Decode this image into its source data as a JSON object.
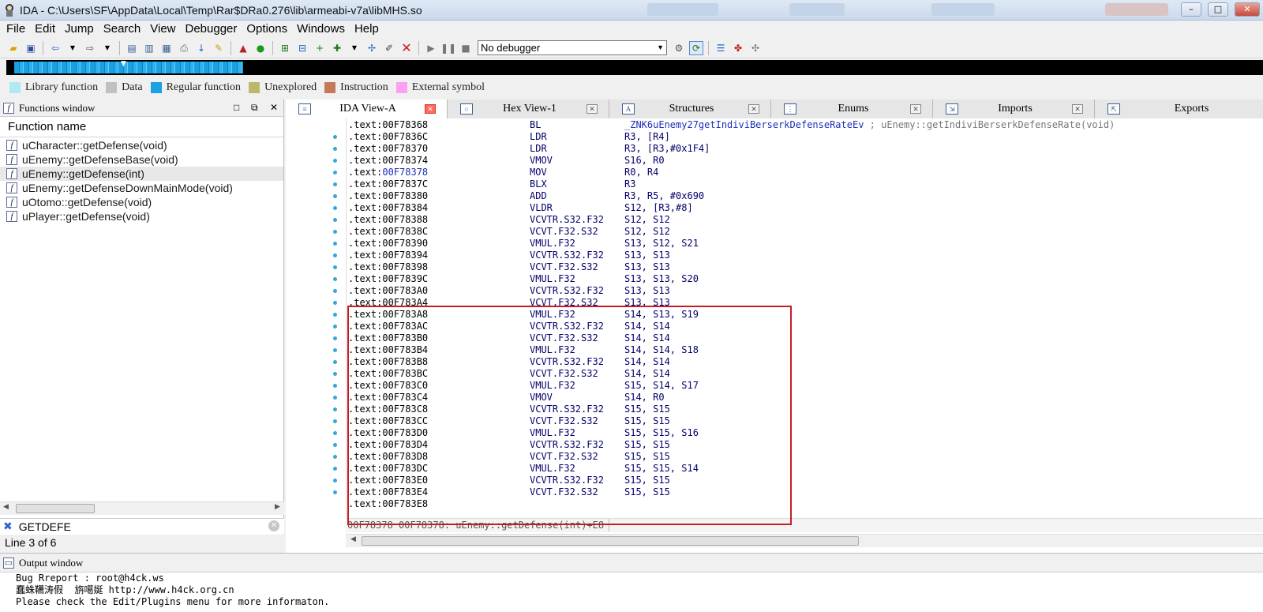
{
  "window": {
    "title": "IDA - C:\\Users\\SF\\AppData\\Local\\Temp\\Rar$DRa0.276\\lib\\armeabi-v7a\\libMHS.so"
  },
  "menu": [
    "File",
    "Edit",
    "Jump",
    "Search",
    "View",
    "Debugger",
    "Options",
    "Windows",
    "Help"
  ],
  "toolbar": {
    "debugger_select": "No debugger"
  },
  "legend": [
    {
      "label": "Library function",
      "color": "#aeeaf6"
    },
    {
      "label": "Data",
      "color": "#c0c0c0"
    },
    {
      "label": "Regular function",
      "color": "#1ba0e2"
    },
    {
      "label": "Unexplored",
      "color": "#bdb76b"
    },
    {
      "label": "Instruction",
      "color": "#c47a5a"
    },
    {
      "label": "External symbol",
      "color": "#ff9ff3"
    }
  ],
  "functions_window": {
    "title": "Functions window",
    "column": "Function name",
    "items": [
      "uCharacter::getDefense(void)",
      "uEnemy::getDefenseBase(void)",
      "uEnemy::getDefense(int)",
      "uEnemy::getDefenseDownMainMode(void)",
      "uOtomo::getDefense(void)",
      "uPlayer::getDefense(void)"
    ],
    "search_text": "GETDEFE",
    "status": "Line 3 of 6"
  },
  "tabs": [
    {
      "label": "IDA View-A",
      "icon": "ida-view-icon"
    },
    {
      "label": "Hex View-1",
      "icon": "hex-icon"
    },
    {
      "label": "Structures",
      "icon": "structures-icon"
    },
    {
      "label": "Enums",
      "icon": "enums-icon"
    },
    {
      "label": "Imports",
      "icon": "imports-icon"
    },
    {
      "label": "Exports",
      "icon": "exports-icon"
    }
  ],
  "disasm": {
    "lines": [
      {
        "seg": ".text:",
        "addr": "00F78368",
        "mn": "BL",
        "ops": "_ZNK6uEnemy27getIndiviBerserkDefenseRateEv",
        "comment": " ; uEnemy::getIndiviBerserkDefenseRate(void)"
      },
      {
        "seg": ".text:",
        "addr": "00F7836C",
        "mn": "LDR",
        "ops": "R3, [R4]",
        "comment": ""
      },
      {
        "seg": ".text:",
        "addr": "00F78370",
        "mn": "LDR",
        "ops": "R3, [R3,#0x1F4]",
        "comment": ""
      },
      {
        "seg": ".text:",
        "addr": "00F78374",
        "mn": "VMOV",
        "ops": "S16, R0",
        "comment": ""
      },
      {
        "seg": ".text:",
        "addr": "00F78378",
        "mn": "MOV",
        "ops": "R0, R4",
        "comment": ""
      },
      {
        "seg": ".text:",
        "addr": "00F7837C",
        "mn": "BLX",
        "ops": "R3",
        "comment": ""
      },
      {
        "seg": ".text:",
        "addr": "00F78380",
        "mn": "ADD",
        "ops": "R3, R5, #0x690",
        "comment": ""
      },
      {
        "seg": ".text:",
        "addr": "00F78384",
        "mn": "VLDR",
        "ops": "S12, [R3,#8]",
        "comment": ""
      },
      {
        "seg": ".text:",
        "addr": "00F78388",
        "mn": "VCVTR.S32.F32",
        "ops": "S12, S12",
        "comment": ""
      },
      {
        "seg": ".text:",
        "addr": "00F7838C",
        "mn": "VCVT.F32.S32",
        "ops": "S12, S12",
        "comment": ""
      },
      {
        "seg": ".text:",
        "addr": "00F78390",
        "mn": "VMUL.F32",
        "ops": "S13, S12, S21",
        "comment": ""
      },
      {
        "seg": ".text:",
        "addr": "00F78394",
        "mn": "VCVTR.S32.F32",
        "ops": "S13, S13",
        "comment": ""
      },
      {
        "seg": ".text:",
        "addr": "00F78398",
        "mn": "VCVT.F32.S32",
        "ops": "S13, S13",
        "comment": ""
      },
      {
        "seg": ".text:",
        "addr": "00F7839C",
        "mn": "VMUL.F32",
        "ops": "S13, S13, S20",
        "comment": ""
      },
      {
        "seg": ".text:",
        "addr": "00F783A0",
        "mn": "VCVTR.S32.F32",
        "ops": "S13, S13",
        "comment": ""
      },
      {
        "seg": ".text:",
        "addr": "00F783A4",
        "mn": "VCVT.F32.S32",
        "ops": "S13, S13",
        "comment": ""
      },
      {
        "seg": ".text:",
        "addr": "00F783A8",
        "mn": "VMUL.F32",
        "ops": "S14, S13, S19",
        "comment": ""
      },
      {
        "seg": ".text:",
        "addr": "00F783AC",
        "mn": "VCVTR.S32.F32",
        "ops": "S14, S14",
        "comment": ""
      },
      {
        "seg": ".text:",
        "addr": "00F783B0",
        "mn": "VCVT.F32.S32",
        "ops": "S14, S14",
        "comment": ""
      },
      {
        "seg": ".text:",
        "addr": "00F783B4",
        "mn": "VMUL.F32",
        "ops": "S14, S14, S18",
        "comment": ""
      },
      {
        "seg": ".text:",
        "addr": "00F783B8",
        "mn": "VCVTR.S32.F32",
        "ops": "S14, S14",
        "comment": ""
      },
      {
        "seg": ".text:",
        "addr": "00F783BC",
        "mn": "VCVT.F32.S32",
        "ops": "S14, S14",
        "comment": ""
      },
      {
        "seg": ".text:",
        "addr": "00F783C0",
        "mn": "VMUL.F32",
        "ops": "S15, S14, S17",
        "comment": ""
      },
      {
        "seg": ".text:",
        "addr": "00F783C4",
        "mn": "VMOV",
        "ops": "S14, R0",
        "comment": ""
      },
      {
        "seg": ".text:",
        "addr": "00F783C8",
        "mn": "VCVTR.S32.F32",
        "ops": "S15, S15",
        "comment": ""
      },
      {
        "seg": ".text:",
        "addr": "00F783CC",
        "mn": "VCVT.F32.S32",
        "ops": "S15, S15",
        "comment": ""
      },
      {
        "seg": ".text:",
        "addr": "00F783D0",
        "mn": "VMUL.F32",
        "ops": "S15, S15, S16",
        "comment": ""
      },
      {
        "seg": ".text:",
        "addr": "00F783D4",
        "mn": "VCVTR.S32.F32",
        "ops": "S15, S15",
        "comment": ""
      },
      {
        "seg": ".text:",
        "addr": "00F783D8",
        "mn": "VCVT.F32.S32",
        "ops": "S15, S15",
        "comment": ""
      },
      {
        "seg": ".text:",
        "addr": "00F783DC",
        "mn": "VMUL.F32",
        "ops": "S15, S15, S14",
        "comment": ""
      },
      {
        "seg": ".text:",
        "addr": "00F783E0",
        "mn": "VCVTR.S32.F32",
        "ops": "S15, S15",
        "comment": ""
      },
      {
        "seg": ".text:",
        "addr": "00F783E4",
        "mn": "VCVT.F32.S32",
        "ops": "S15, S15",
        "comment": ""
      },
      {
        "seg": ".text:",
        "addr": "00F783E8",
        "mn": "",
        "ops": "",
        "comment": ""
      }
    ],
    "status_line": "00F78378 00F78378: uEnemy::getDefense(int)+E8"
  },
  "output_window": {
    "title": "Output window",
    "lines": [
      "Bug Rreport : root@h4ck.ws",
      "蠢蛛韉涛假  旃噶娫 http://www.h4ck.org.cn",
      "Please check the Edit/Plugins menu for more informaton."
    ]
  }
}
